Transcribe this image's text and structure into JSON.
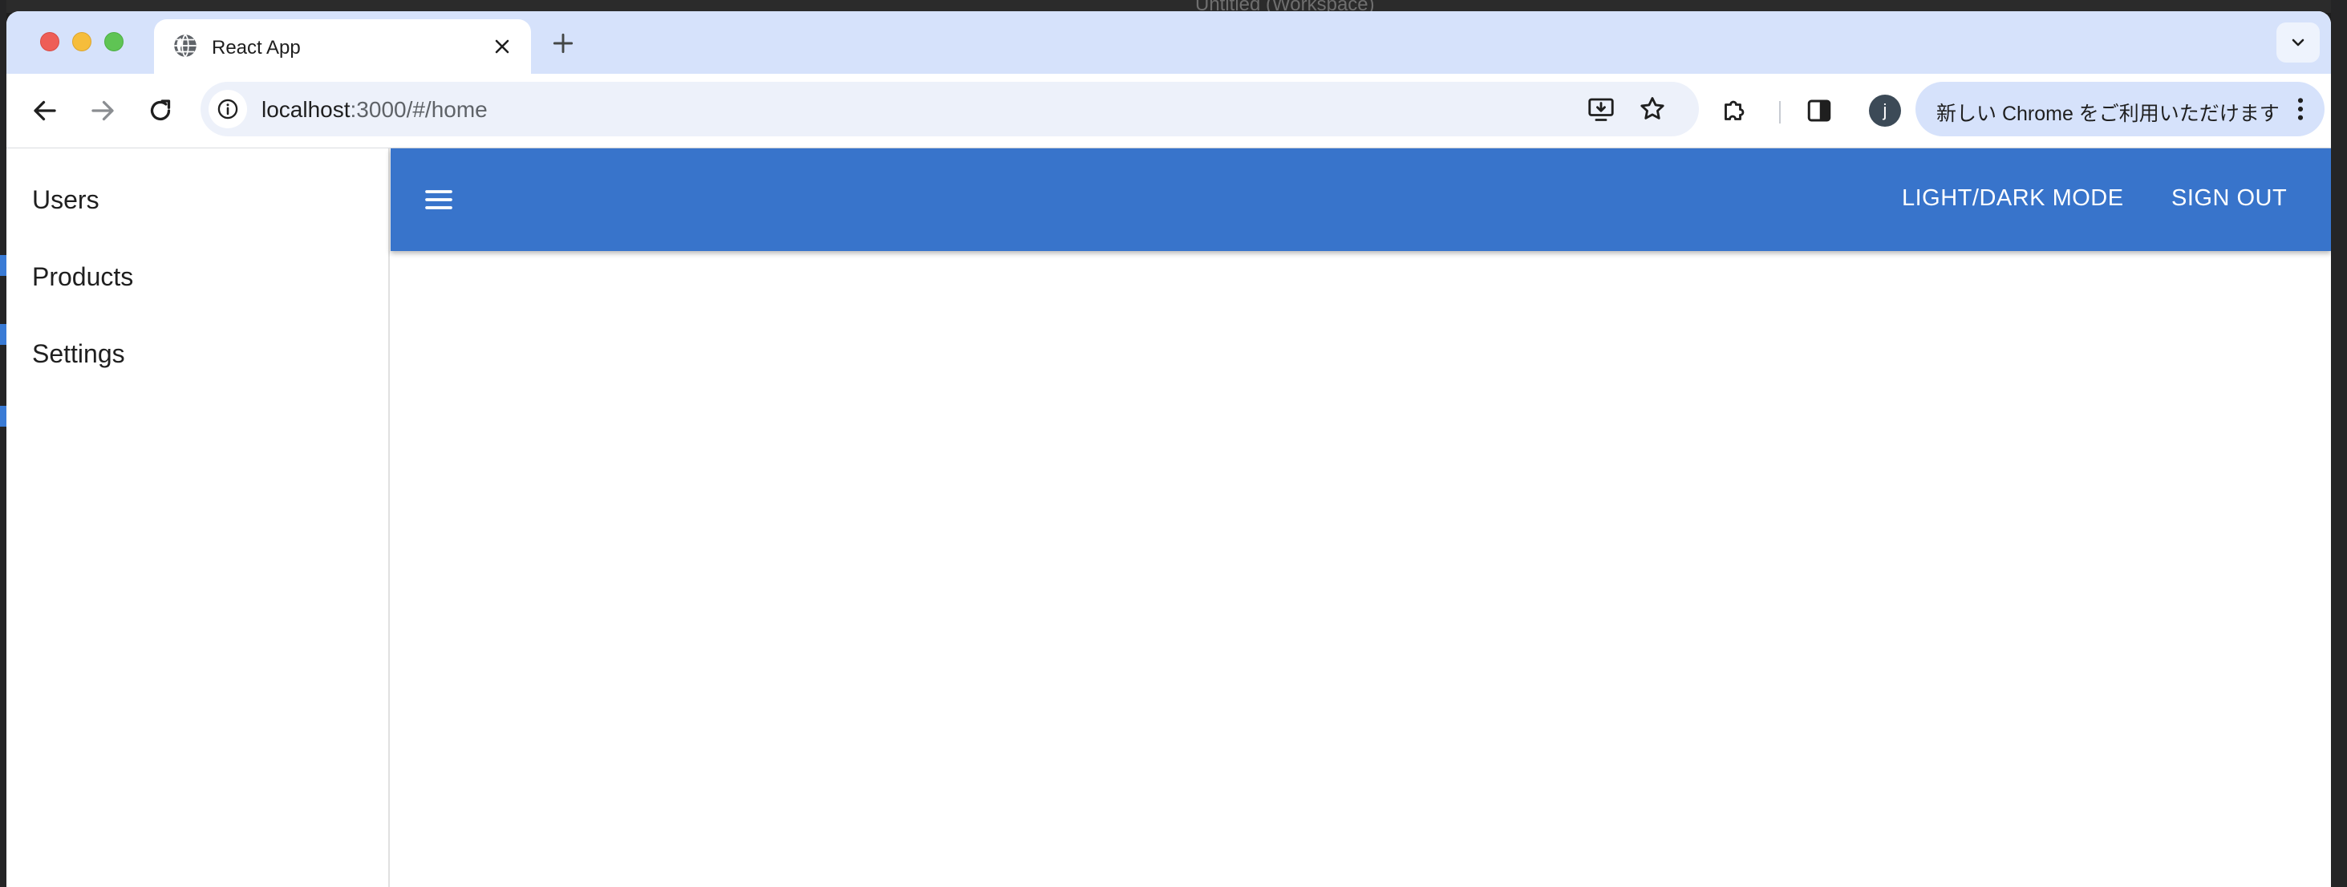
{
  "background": {
    "window_title": "Untitled (Workspace)"
  },
  "browser": {
    "tab": {
      "title": "React App",
      "favicon": "globe-icon"
    },
    "toolbar": {
      "back_icon": "arrow-left-icon",
      "forward_icon": "arrow-right-icon",
      "reload_icon": "reload-icon",
      "url_host": "localhost",
      "url_rest": ":3000/#/home",
      "install_icon": "install-app-icon",
      "bookmark_icon": "star-icon",
      "extensions_icon": "puzzle-icon",
      "side_panel_icon": "side-panel-icon",
      "profile_initial": "j",
      "update_label": "新しい Chrome をご利用いただけます"
    }
  },
  "app": {
    "drawer": {
      "items": [
        {
          "label": "Users"
        },
        {
          "label": "Products"
        },
        {
          "label": "Settings"
        }
      ]
    },
    "appbar": {
      "menu_icon": "hamburger-menu-icon",
      "theme_toggle_label": "LIGHT/DARK MODE",
      "sign_out_label": "SIGN OUT",
      "color": "#3874cb"
    }
  },
  "colors": {
    "tabstrip": "#d6e2fb",
    "omnibox": "#edf1fa",
    "appbar": "#3874cb"
  }
}
